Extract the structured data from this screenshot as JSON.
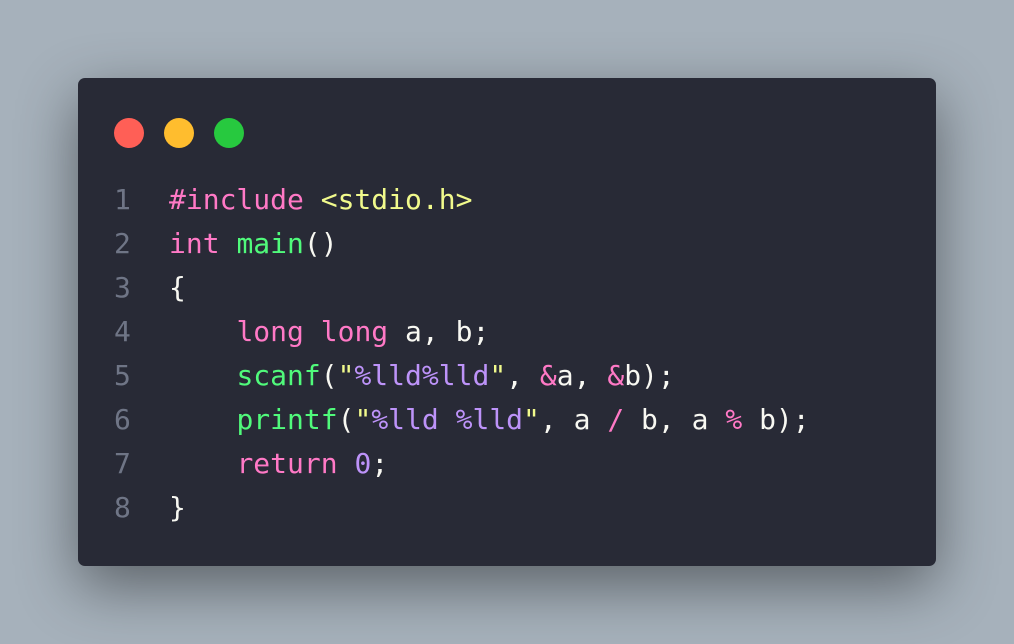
{
  "colors": {
    "background": "#a6b1bb",
    "window": "#282a36",
    "dot_red": "#ff5f56",
    "dot_yellow": "#ffbd2e",
    "dot_green": "#27c93f",
    "keyword": "#ff79c6",
    "function": "#50fa7b",
    "string": "#f1fa8c",
    "number": "#bd93f9",
    "text": "#f8f8f2",
    "line_number": "#6f7586"
  },
  "window_controls": [
    "close",
    "minimize",
    "maximize"
  ],
  "code": {
    "lines": [
      {
        "number": "1",
        "tokens": [
          {
            "text": "#include",
            "class": "t-pink"
          },
          {
            "text": " ",
            "class": "t-white"
          },
          {
            "text": "<stdio.h>",
            "class": "t-yellow"
          }
        ]
      },
      {
        "number": "2",
        "tokens": [
          {
            "text": "int",
            "class": "t-pink"
          },
          {
            "text": " ",
            "class": "t-white"
          },
          {
            "text": "main",
            "class": "t-green"
          },
          {
            "text": "()",
            "class": "t-white"
          }
        ]
      },
      {
        "number": "3",
        "tokens": [
          {
            "text": "{",
            "class": "t-white"
          }
        ]
      },
      {
        "number": "4",
        "tokens": [
          {
            "text": "    ",
            "class": "t-white"
          },
          {
            "text": "long",
            "class": "t-pink"
          },
          {
            "text": " ",
            "class": "t-white"
          },
          {
            "text": "long",
            "class": "t-pink"
          },
          {
            "text": " a, b;",
            "class": "t-white"
          }
        ]
      },
      {
        "number": "5",
        "tokens": [
          {
            "text": "    ",
            "class": "t-white"
          },
          {
            "text": "scanf",
            "class": "t-green"
          },
          {
            "text": "(",
            "class": "t-white"
          },
          {
            "text": "\"",
            "class": "t-yellow"
          },
          {
            "text": "%lld%lld",
            "class": "t-purple"
          },
          {
            "text": "\"",
            "class": "t-yellow"
          },
          {
            "text": ", ",
            "class": "t-white"
          },
          {
            "text": "&",
            "class": "t-pink"
          },
          {
            "text": "a, ",
            "class": "t-white"
          },
          {
            "text": "&",
            "class": "t-pink"
          },
          {
            "text": "b);",
            "class": "t-white"
          }
        ]
      },
      {
        "number": "6",
        "tokens": [
          {
            "text": "    ",
            "class": "t-white"
          },
          {
            "text": "printf",
            "class": "t-green"
          },
          {
            "text": "(",
            "class": "t-white"
          },
          {
            "text": "\"",
            "class": "t-yellow"
          },
          {
            "text": "%lld",
            "class": "t-purple"
          },
          {
            "text": " ",
            "class": "t-yellow"
          },
          {
            "text": "%lld",
            "class": "t-purple"
          },
          {
            "text": "\"",
            "class": "t-yellow"
          },
          {
            "text": ", a ",
            "class": "t-white"
          },
          {
            "text": "/",
            "class": "t-pink"
          },
          {
            "text": " b, a ",
            "class": "t-white"
          },
          {
            "text": "%",
            "class": "t-pink"
          },
          {
            "text": " b);",
            "class": "t-white"
          }
        ]
      },
      {
        "number": "7",
        "tokens": [
          {
            "text": "    ",
            "class": "t-white"
          },
          {
            "text": "return",
            "class": "t-pink"
          },
          {
            "text": " ",
            "class": "t-white"
          },
          {
            "text": "0",
            "class": "t-purple"
          },
          {
            "text": ";",
            "class": "t-white"
          }
        ]
      },
      {
        "number": "8",
        "tokens": [
          {
            "text": "}",
            "class": "t-white"
          }
        ]
      }
    ]
  }
}
